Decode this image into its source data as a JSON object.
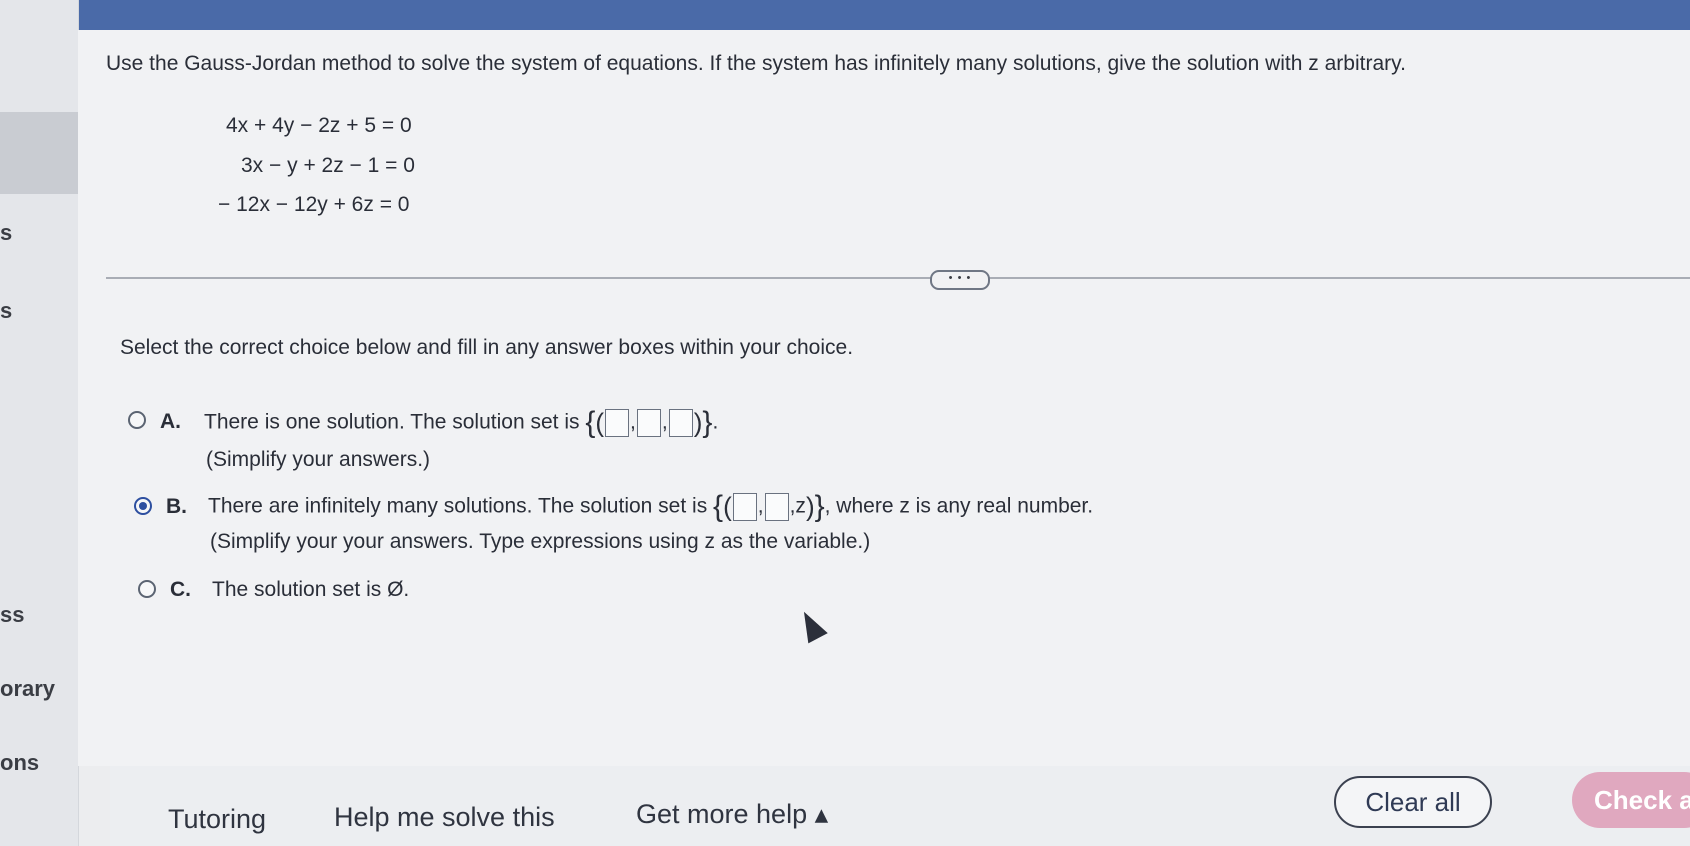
{
  "sidebar": {
    "labels": [
      "s",
      "s",
      "ss",
      "orary",
      "ons"
    ]
  },
  "question": {
    "text": "Use the Gauss-Jordan method to solve the system of equations. If the system has infinitely many solutions, give the solution with z arbitrary.",
    "equations": [
      "4x + 4y − 2z + 5 = 0",
      "3x − y + 2z − 1 = 0",
      "− 12x − 12y + 6z = 0"
    ]
  },
  "more_button": "• • •",
  "instruction": "Select the correct choice below and fill in any answer boxes within your choice.",
  "choices": {
    "a": {
      "letter": "A.",
      "text": "There is one solution. The solution set is",
      "sub": "(Simplify your answers.)"
    },
    "b": {
      "letter": "B.",
      "text": "There are infinitely many solutions. The solution set is",
      "z": ",z",
      "tail": ", where z is any real number.",
      "sub": "(Simplify your your answers. Type expressions using z as the variable.)"
    },
    "c": {
      "letter": "C.",
      "text": "The solution set is Ø."
    }
  },
  "selected_choice": "B",
  "footer": {
    "tutoring": "Tutoring",
    "help_me_solve": "Help me solve this",
    "get_more_help": "Get more help ▴",
    "clear_all": "Clear all",
    "check_answer": "Check a"
  }
}
